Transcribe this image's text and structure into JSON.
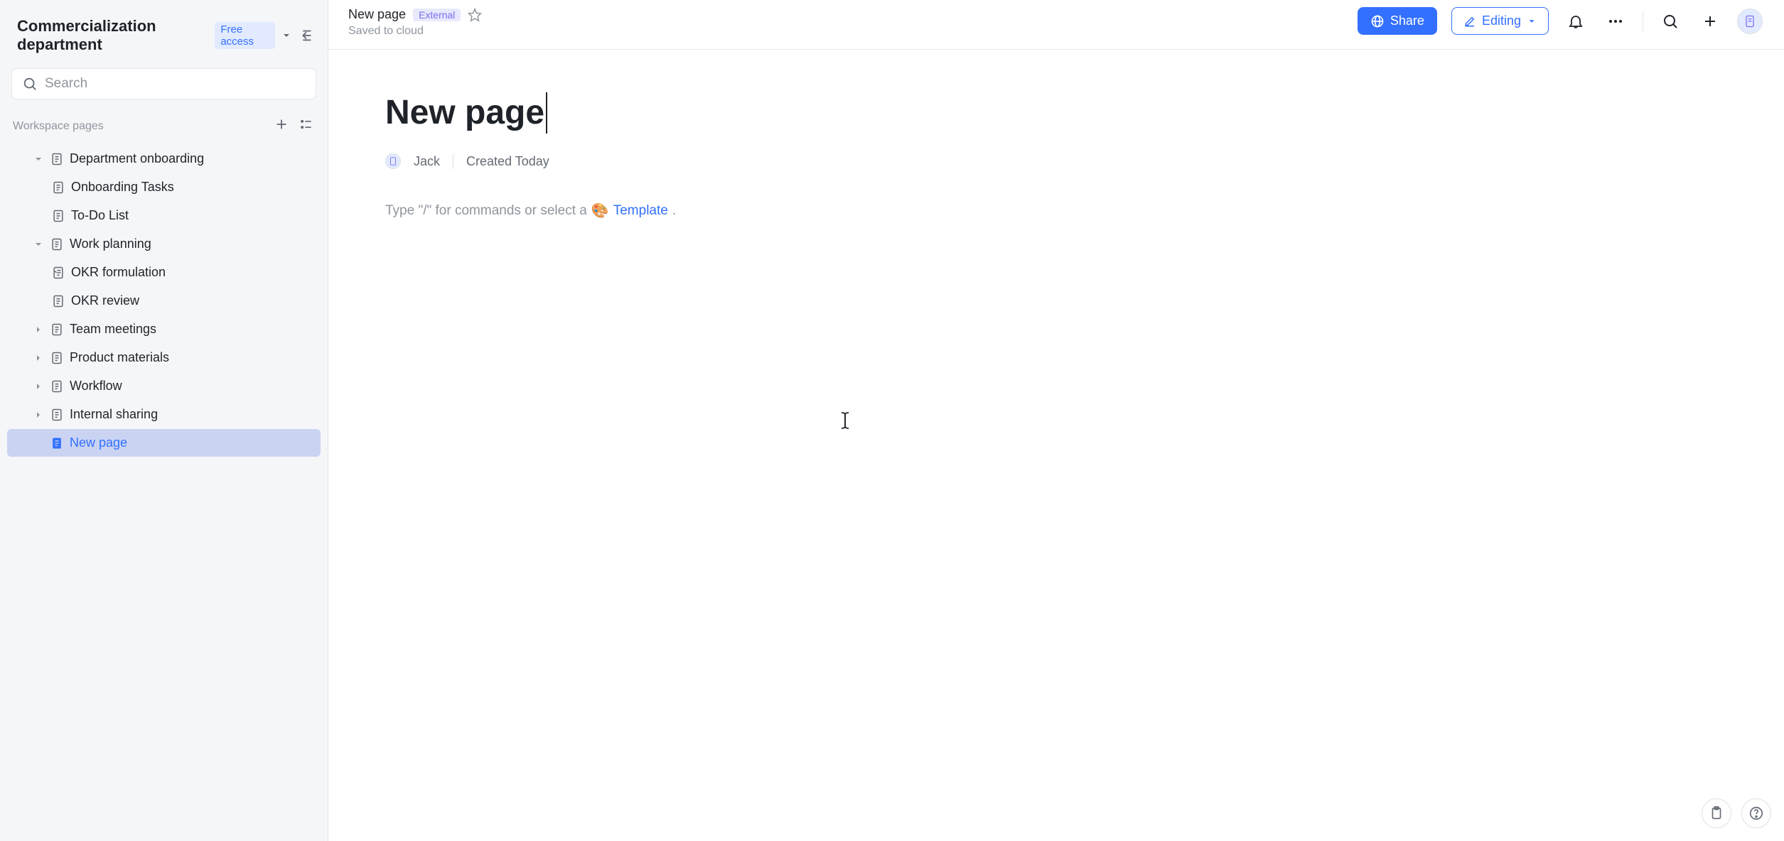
{
  "sidebar": {
    "workspace_title": "Commercialization department",
    "free_badge": "Free access",
    "search_placeholder": "Search",
    "section_title": "Workspace pages",
    "tree": [
      {
        "label": "Department onboarding",
        "expanded": true,
        "children": [
          {
            "label": "Onboarding Tasks"
          },
          {
            "label": "To-Do List"
          }
        ]
      },
      {
        "label": "Work planning",
        "expanded": true,
        "children": [
          {
            "label": "OKR formulation"
          },
          {
            "label": "OKR review"
          }
        ]
      },
      {
        "label": "Team meetings",
        "expanded": false,
        "children": []
      },
      {
        "label": "Product materials",
        "expanded": false,
        "children": []
      },
      {
        "label": "Workflow",
        "expanded": false,
        "children": []
      },
      {
        "label": "Internal sharing",
        "expanded": false,
        "children": []
      },
      {
        "label": "New page",
        "expanded": null,
        "selected": true,
        "children": []
      }
    ]
  },
  "header": {
    "breadcrumb_title": "New page",
    "external_badge": "External",
    "save_status": "Saved to cloud",
    "share_label": "Share",
    "editing_label": "Editing"
  },
  "document": {
    "title": "New page",
    "author": "Jack",
    "created_label": "Created Today",
    "placeholder_prefix": "Type \"/\" for commands or select a ",
    "template_label": "Template",
    "placeholder_suffix": "."
  }
}
